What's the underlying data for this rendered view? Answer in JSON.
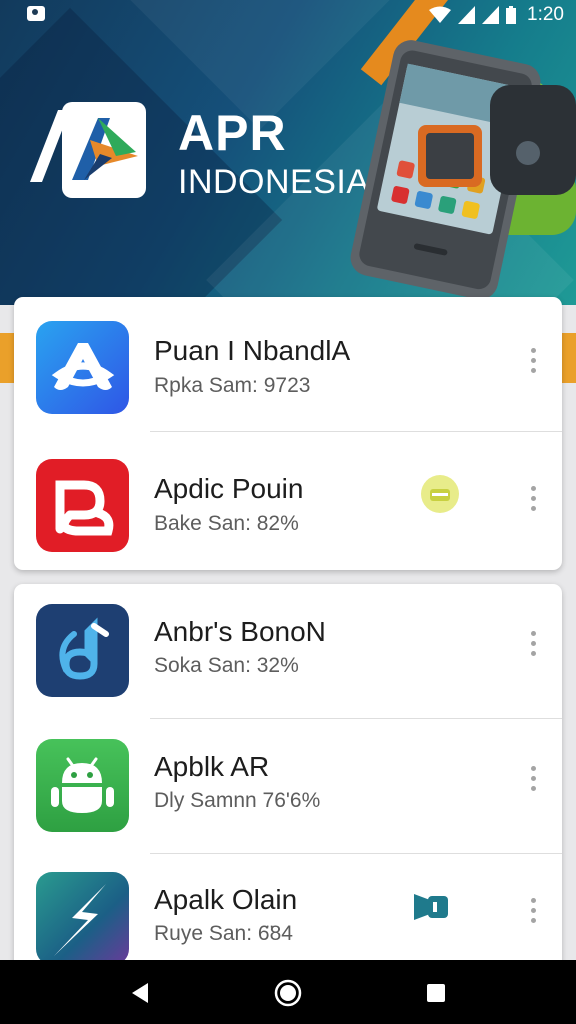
{
  "status_bar": {
    "time": "1:20",
    "icons": [
      "notification-icon",
      "wifi-icon",
      "signal-icon",
      "signal-icon",
      "battery-icon"
    ]
  },
  "banner": {
    "title": "APR",
    "subtitle": "INDONESIA",
    "colors": {
      "bg_dark": "#123a5c",
      "bg_teal": "#1f9a96",
      "accent_orange": "#e58a1e"
    }
  },
  "apps": [
    {
      "name": "Puan I NbandlA",
      "meta": "Rpka Sam: 9723",
      "icon": "a-logo-icon",
      "icon_color": "#2f6fe8"
    },
    {
      "name": "Apdic Pouin",
      "meta": "Bake San: 82%",
      "icon": "loop-logo-icon",
      "icon_color": "#e11d26",
      "badge": "yellow-badge-icon"
    },
    {
      "name": "Anbr's BonoN",
      "meta": "Soka San: 32%",
      "icon": "music-note-icon",
      "icon_color": "#1e3f72"
    },
    {
      "name": "Apblk AR",
      "meta": "Dly Samnn 76'6%",
      "icon": "android-icon",
      "icon_color": "#3fbf4e"
    },
    {
      "name": "Apalk Olain",
      "meta": "Ruye San: 6̈84",
      "icon": "lightning-icon",
      "icon_color": "#1d6a8a",
      "badge": "video-camera-icon"
    }
  ],
  "nav_bar": {
    "buttons": [
      "back-icon",
      "home-icon",
      "recent-apps-icon"
    ]
  }
}
